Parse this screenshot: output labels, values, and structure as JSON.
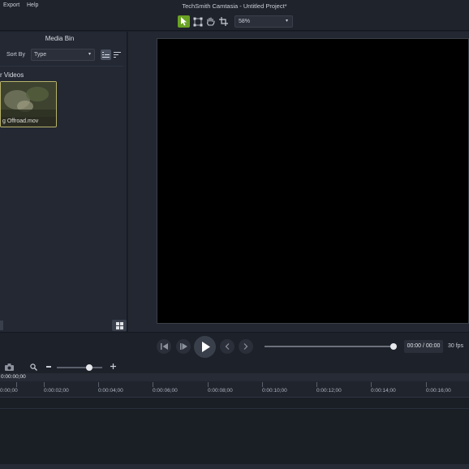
{
  "menu": {
    "export": "Export",
    "help": "Help"
  },
  "app_title": "TechSmith Camtasia - Untitled Project*",
  "toolbar": {
    "tools": [
      "select-arrow",
      "edit-nodes",
      "pan-hand",
      "crop"
    ],
    "zoom": "58%"
  },
  "media_bin": {
    "title": "Media Bin",
    "sort_by_label": "Sort By",
    "sort_value": "Type",
    "section_title": "r Videos",
    "items": [
      {
        "name": "g Offroad.mov"
      }
    ]
  },
  "playback": {
    "time": "00:00 / 00:00",
    "fps": "30 fps"
  },
  "timeline": {
    "playhead_time": "0:00:00;00",
    "ticks": [
      "0:00;00",
      "0:00:02;00",
      "0:00:04;00",
      "0:00:06;00",
      "0:00:08;00",
      "0:00:10;00",
      "0:00:12;00",
      "0:00:14;00",
      "0:00:16;00"
    ]
  },
  "colors": {
    "accent": "#6aa223",
    "background": "#1b1f27",
    "canvas": "#000000"
  }
}
